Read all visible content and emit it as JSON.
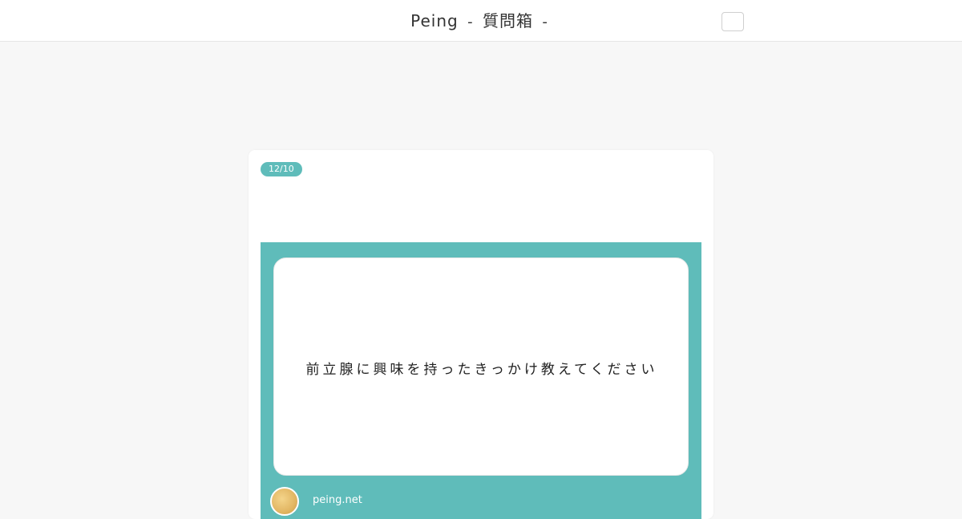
{
  "header": {
    "brand": "Peing",
    "separator_left": "-",
    "subtitle": "質問箱",
    "separator_right": "-"
  },
  "post": {
    "date": "12/10",
    "question": "前立腺に興味を持ったきっかけ教えてください",
    "site": "peing.net"
  },
  "icons": {
    "menu": "menu-icon",
    "avatar": "avatar-icon"
  },
  "colors": {
    "accent": "#5fbcba",
    "background": "#f7f7f7",
    "card": "#ffffff"
  }
}
